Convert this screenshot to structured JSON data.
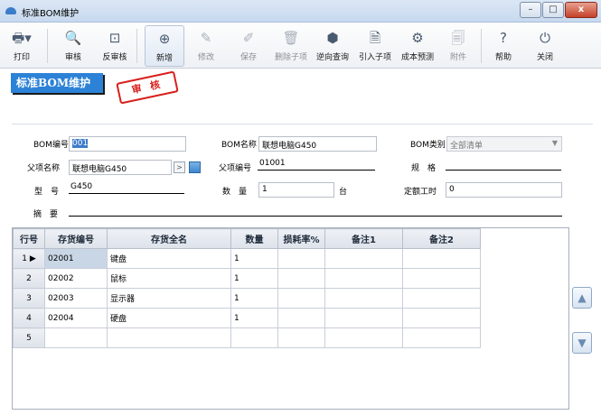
{
  "window": {
    "title": "标准BOM维护",
    "minimize": "–",
    "maximize": "□",
    "close": "x"
  },
  "toolbar": {
    "print": "打印",
    "audit": "审核",
    "unaudit": "反审核",
    "new": "新增",
    "edit": "修改",
    "save": "保存",
    "delete_child": "删除子项",
    "reverse_query": "逆向查询",
    "import_child": "引入子项",
    "cost_forecast": "成本预测",
    "attachment": "附件",
    "help": "帮助",
    "close": "关闭"
  },
  "banner": {
    "title": "标准BOM维护",
    "stamp": "审 核"
  },
  "form": {
    "bom_code_label": "BOM编号",
    "bom_code_value": "001",
    "bom_name_label": "BOM名称",
    "bom_name_value": "联想电脑G450",
    "bom_type_label": "BOM类别",
    "bom_type_value": "全部清单",
    "parent_name_label": "父项名称",
    "parent_name_value": "联想电脑G450",
    "parent_code_label": "父项编号",
    "parent_code_value": "01001",
    "spec_label": "规　格",
    "spec_value": "",
    "model_label": "型　号",
    "model_value": "G450",
    "qty_label": "数　量",
    "qty_value": "1",
    "unit_value": "台",
    "labor_label": "定额工时",
    "labor_value": "0",
    "summary_label": "摘　要",
    "summary_value": ""
  },
  "grid": {
    "headers": [
      "行号",
      "存货编号",
      "存货全名",
      "数量",
      "损耗率%",
      "备注1",
      "备注2"
    ],
    "rows": [
      {
        "no": "1",
        "code": "02001",
        "name": "键盘",
        "qty": "1",
        "loss": "",
        "note1": "",
        "note2": ""
      },
      {
        "no": "2",
        "code": "02002",
        "name": "鼠标",
        "qty": "1",
        "loss": "",
        "note1": "",
        "note2": ""
      },
      {
        "no": "3",
        "code": "02003",
        "name": "显示器",
        "qty": "1",
        "loss": "",
        "note1": "",
        "note2": ""
      },
      {
        "no": "4",
        "code": "02004",
        "name": "硬盘",
        "qty": "1",
        "loss": "",
        "note1": "",
        "note2": ""
      },
      {
        "no": "5",
        "code": "",
        "name": "",
        "qty": "",
        "loss": "",
        "note1": "",
        "note2": ""
      }
    ]
  },
  "colors": {
    "accent": "#2c82d6",
    "stamp": "#d8201c"
  }
}
